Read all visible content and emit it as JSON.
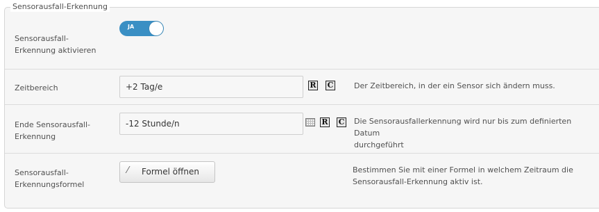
{
  "section": {
    "legend": "Sensorausfall-Erkennung"
  },
  "rows": {
    "activate": {
      "label_line1": "Sensorausfall-",
      "label_line2": "Erkennung aktivieren",
      "toggle_text": "JA"
    },
    "timerange": {
      "label": "Zeitbereich",
      "value": "+2 Tag/e",
      "icon_r": "R",
      "icon_c": "C",
      "description": "Der Zeitbereich, in der ein Sensor sich ändern muss."
    },
    "end": {
      "label_line1": "Ende Sensorausfall-",
      "label_line2": "Erkennung",
      "value": "-12 Stunde/n",
      "icon_calendar": "calendar-icon",
      "icon_r": "R",
      "icon_c": "C",
      "description_line1": "Die Sensorausfallerkennung wird nur bis zum definierten Datum",
      "description_line2": "durchgeführt"
    },
    "formula": {
      "label_line1": "Sensorausfall-",
      "label_line2": "Erkennungsformel",
      "button_label": "Formel öffnen",
      "description_line1": "Bestimmen Sie mit einer Formel in welchem Zeitraum die",
      "description_line2": "Sensorausfall-Erkennung aktiv ist."
    }
  },
  "colors": {
    "toggle_on": "#3a8fc4",
    "panel_bg": "#f6f6f6",
    "border": "#d6d6d6"
  }
}
